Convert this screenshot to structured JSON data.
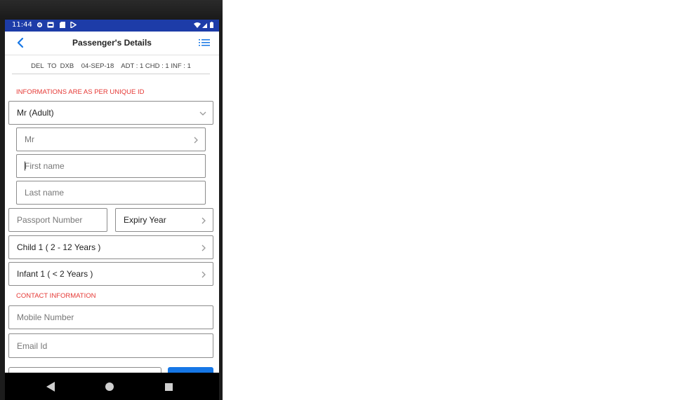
{
  "status_bar": {
    "time": "11:44",
    "icons": [
      "gear-icon",
      "sim-icon",
      "sd-card-icon",
      "play-store-icon"
    ],
    "right_icons": [
      "wifi-icon",
      "signal-icon",
      "battery-icon"
    ]
  },
  "app_bar": {
    "title": "Passenger's Details",
    "back_icon": "chevron-left-icon",
    "menu_icon": "list-icon",
    "accent": "#1677e6"
  },
  "trip_summary": "DEL  TO  DXB    04-SEP-18    ADT : 1 CHD : 1 INF : 1",
  "sections": {
    "unique_id": "INFORMATIONS ARE AS PER UNIQUE ID",
    "contact": "CONTACT INFORMATION"
  },
  "passenger": {
    "type_select": "Mr (Adult)",
    "title_select": "Mr",
    "first_name_placeholder": "First name",
    "last_name_placeholder": "Last name",
    "passport_placeholder": "Passport Number",
    "expiry_select": "Expiry Year"
  },
  "additional": {
    "child": "Child 1 ( 2 - 12 Years )",
    "infant": "Infant 1 ( < 2 Years )"
  },
  "contact": {
    "mobile_placeholder": "Mobile Number",
    "email_placeholder": "Email Id"
  },
  "nav_bar": [
    "back-triangle-icon",
    "home-icon",
    "recents-icon"
  ],
  "colors": {
    "status_bar": "#1d3ca8",
    "section_label": "#e53935",
    "button": "#1677e6"
  }
}
